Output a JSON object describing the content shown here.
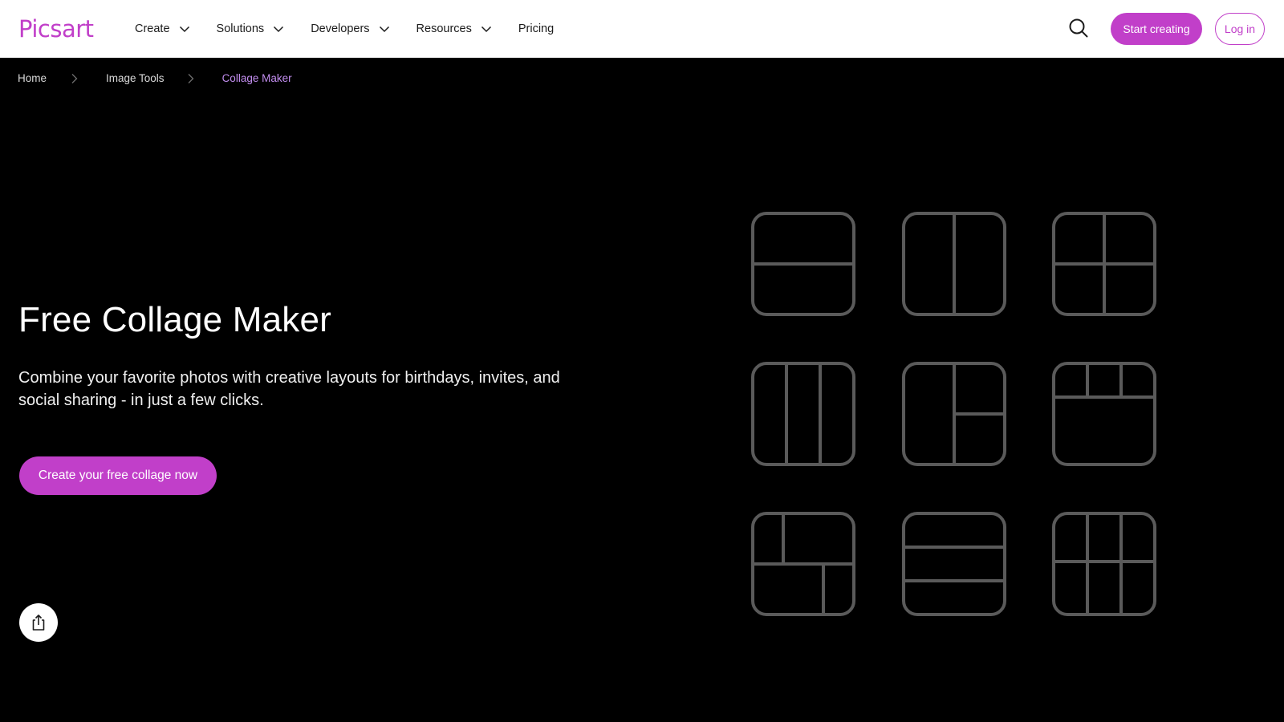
{
  "brand": {
    "logo_text": "Picsart",
    "accent": "#c13fc9"
  },
  "nav": {
    "items": [
      {
        "label": "Create",
        "has_dropdown": true
      },
      {
        "label": "Solutions",
        "has_dropdown": true
      },
      {
        "label": "Developers",
        "has_dropdown": true
      },
      {
        "label": "Resources",
        "has_dropdown": true
      },
      {
        "label": "Pricing",
        "has_dropdown": false
      }
    ]
  },
  "header_actions": {
    "search_icon": "search-icon",
    "start_label": "Start creating",
    "login_label": "Log in"
  },
  "breadcrumb": {
    "items": [
      "Home",
      "Image Tools",
      "Collage Maker"
    ]
  },
  "hero": {
    "title": "Free Collage Maker",
    "subtitle": "Combine your favorite photos with creative layouts for birthdays, invites, and social sharing - in just a few clicks.",
    "cta_label": "Create your free collage now"
  },
  "share": {
    "icon": "share-icon"
  },
  "layout_icons": [
    "layout-two-rows-icon",
    "layout-two-columns-icon",
    "layout-four-grid-icon",
    "layout-three-columns-icon",
    "layout-left-tall-right-split-icon",
    "layout-top-three-bottom-wide-icon",
    "layout-top-split-bottom-split-icon",
    "layout-three-rows-icon",
    "layout-six-grid-icon"
  ]
}
